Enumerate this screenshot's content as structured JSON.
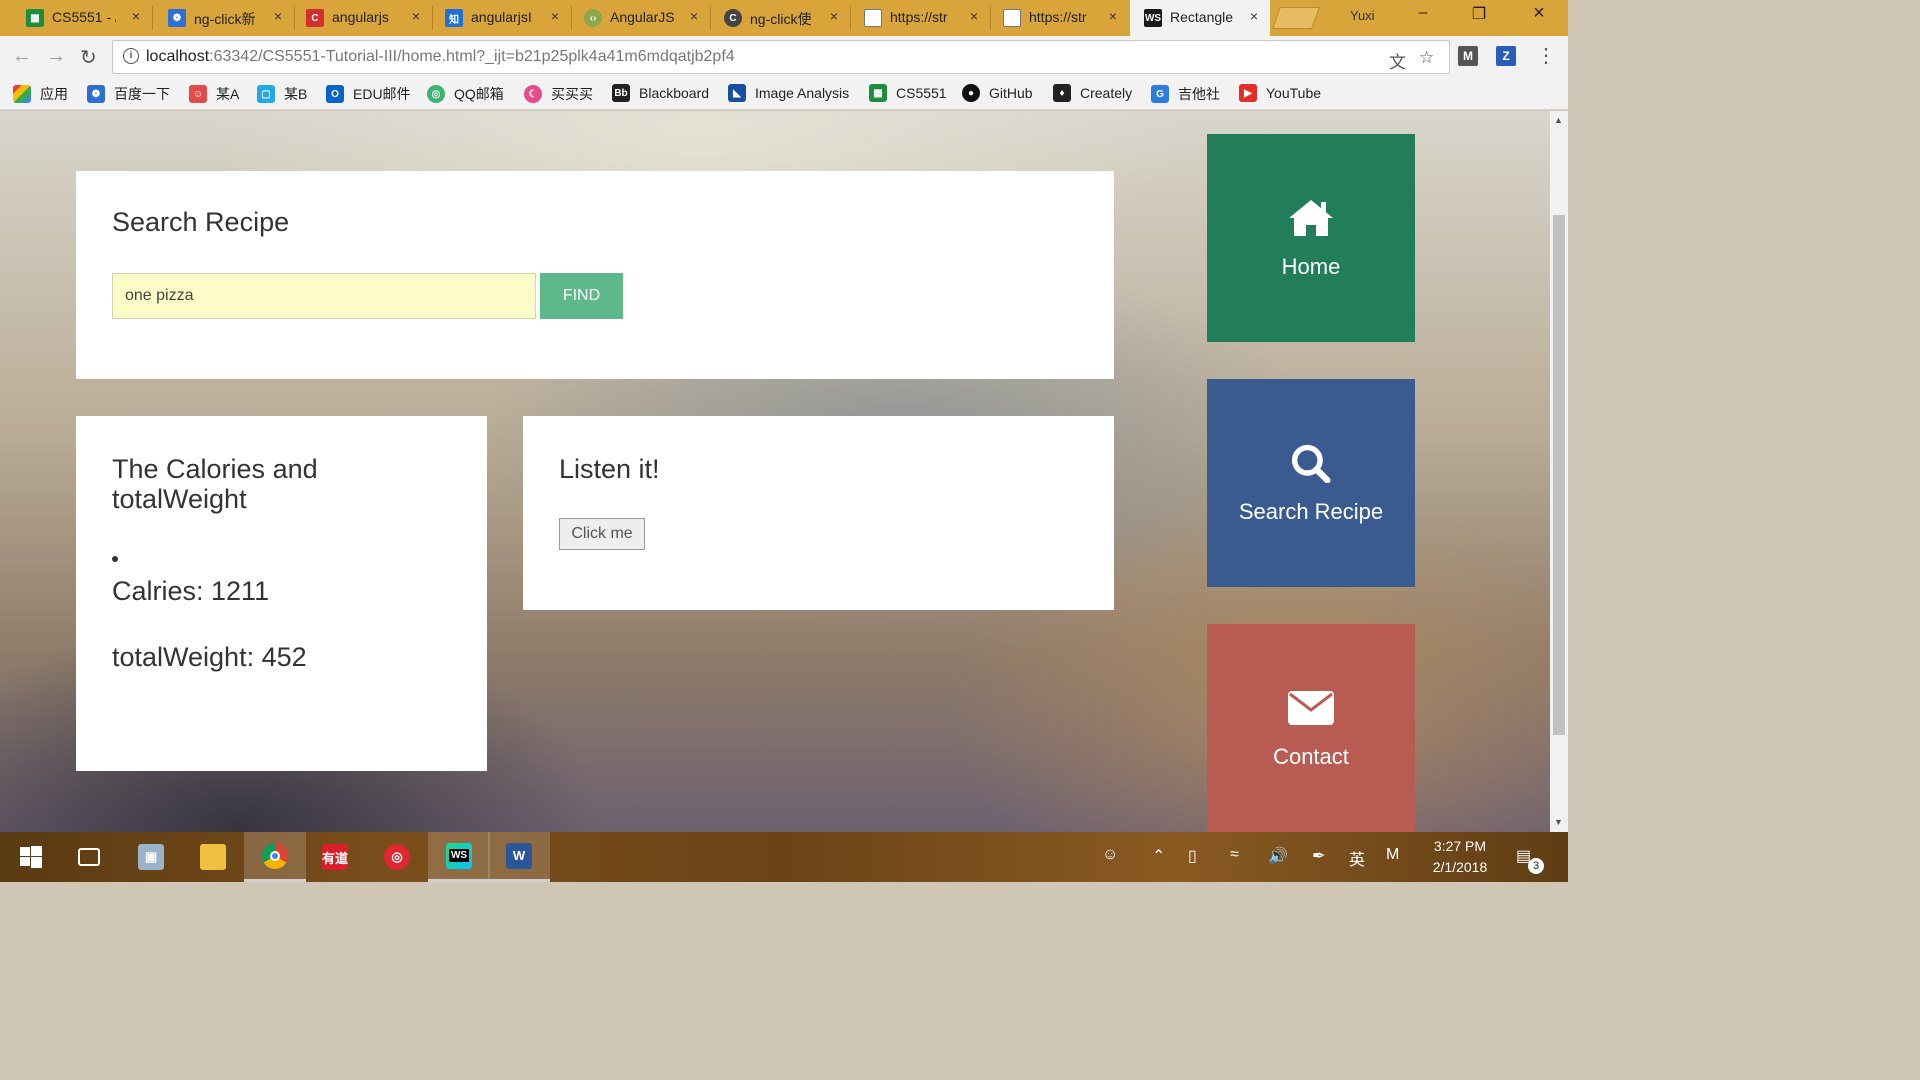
{
  "browser": {
    "tabs": [
      {
        "label": "CS5551 - /",
        "icon": "sheets-icon",
        "color": "#1e8e3e"
      },
      {
        "label": "ng-click新",
        "icon": "paw-icon",
        "color": "#2d6fd2"
      },
      {
        "label": "angularjs",
        "icon": "c-logo-icon",
        "color": "#d32f2f"
      },
      {
        "label": "angularjsI",
        "icon": "zhihu-icon",
        "color": "#1e6fd9"
      },
      {
        "label": "AngularJS",
        "icon": "angular-icon",
        "color": "#8aa84a"
      },
      {
        "label": "ng-click使",
        "icon": "c-logo-icon",
        "color": "#444444"
      },
      {
        "label": "https://str",
        "icon": "page-icon",
        "color": "#777777"
      },
      {
        "label": "https://str",
        "icon": "page-icon",
        "color": "#777777"
      },
      {
        "label": "Rectangle",
        "icon": "webstorm-icon",
        "color": "#1b1b1b"
      }
    ],
    "close_glyph": "×",
    "user_name": "Yuxi",
    "url_host": "localhost",
    "url_rest": ":63342/CS5551-Tutorial-III/home.html?_ijt=b21p25plk4a41m6mdqatjb2pf4",
    "bookmarks": [
      {
        "label": "应用",
        "icon": "apps-grid-icon",
        "color": "#4285f4"
      },
      {
        "label": "百度一下",
        "icon": "paw-icon",
        "color": "#2d6fd2"
      },
      {
        "label": "某A",
        "icon": "acfun-icon",
        "color": "#e24b4b"
      },
      {
        "label": "某B",
        "icon": "bilibili-icon",
        "color": "#23a9e8"
      },
      {
        "label": "EDU邮件",
        "icon": "outlook-icon",
        "color": "#0a64c8"
      },
      {
        "label": "QQ邮箱",
        "icon": "qqmail-icon",
        "color": "#3cb371"
      },
      {
        "label": "买买买",
        "icon": "moon-icon",
        "color": "#e74c8a"
      },
      {
        "label": "Blackboard",
        "icon": "blackboard-icon",
        "color": "#222222"
      },
      {
        "label": "Image Analysis",
        "icon": "flag-icon",
        "color": "#1a4fa0"
      },
      {
        "label": "CS5551",
        "icon": "sheets-icon",
        "color": "#1e8e3e"
      },
      {
        "label": "GitHub",
        "icon": "github-icon",
        "color": "#111111"
      },
      {
        "label": "Creately",
        "icon": "bulb-icon",
        "color": "#222222"
      },
      {
        "label": "吉他社",
        "icon": "g-logo-icon",
        "color": "#2d7de0"
      },
      {
        "label": "YouTube",
        "icon": "youtube-icon",
        "color": "#e52d27"
      }
    ]
  },
  "page": {
    "search_card": {
      "title": "Search Recipe",
      "input_value": "one pizza",
      "find_label": "FIND"
    },
    "calories_card": {
      "title": "The Calories and totalWeight",
      "calories_line": "Calries: 1211",
      "weight_line": "totalWeight: 452"
    },
    "listen_card": {
      "title": "Listen it!",
      "button_label": "Click me"
    },
    "nav_tiles": [
      {
        "label": "Home",
        "icon": "home-icon",
        "color": "#227e5a"
      },
      {
        "label": "Search Recipe",
        "icon": "search-icon",
        "color": "#3a5b90"
      },
      {
        "label": "Contact",
        "icon": "envelope-icon",
        "color": "#b85b52"
      }
    ]
  },
  "taskbar": {
    "ime_label": "英",
    "ime_mode": "M",
    "time": "3:27 PM",
    "date": "2/1/2018",
    "notification_count": "3"
  }
}
